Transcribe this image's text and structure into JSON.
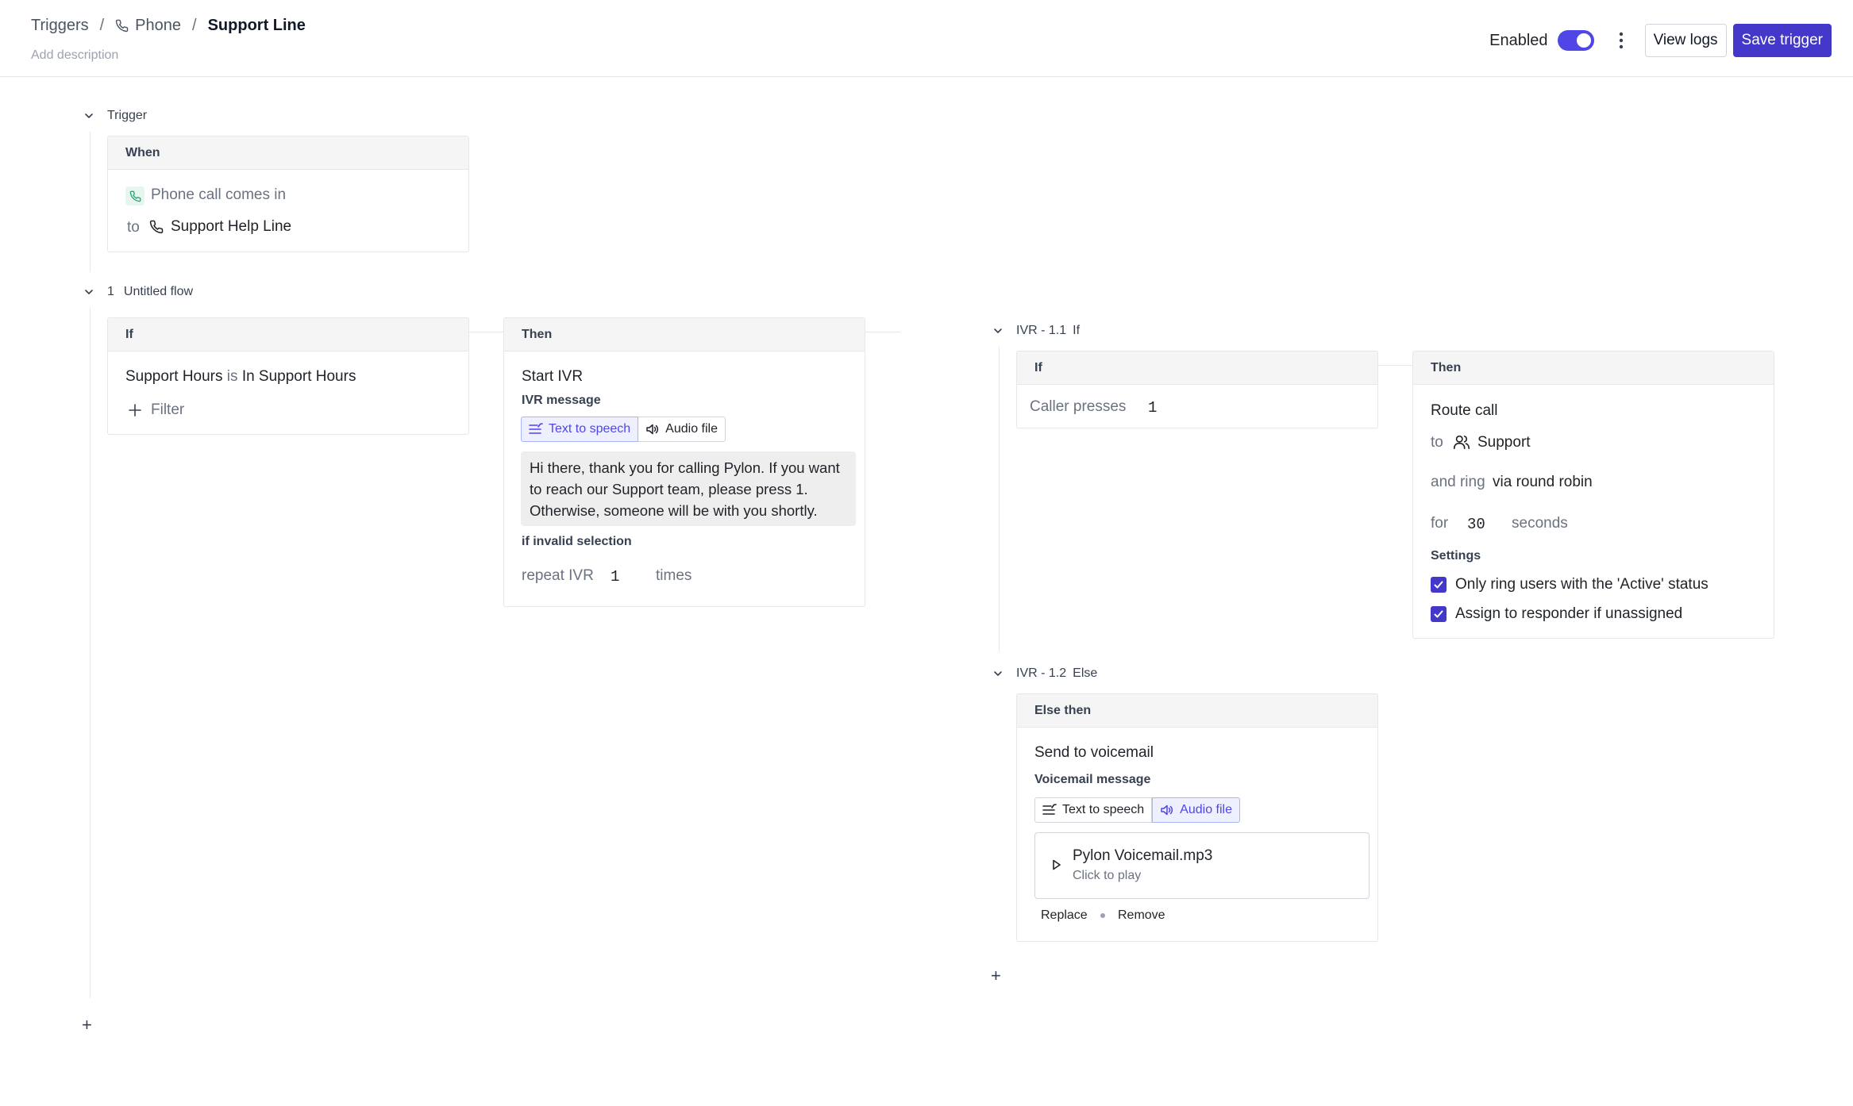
{
  "breadcrumb": {
    "triggers": "Triggers",
    "phone": "Phone",
    "current": "Support Line",
    "add_description": "Add description"
  },
  "header": {
    "enabled_label": "Enabled",
    "view_logs": "View logs",
    "save_trigger": "Save trigger"
  },
  "trigger": {
    "section_title": "Trigger",
    "card_head": "When",
    "event": "Phone call comes in",
    "to_label": "to",
    "line_name": "Support Help Line"
  },
  "flow": {
    "number": "1",
    "title": "Untitled flow",
    "if_card": {
      "head": "If",
      "condition_field": "Support Hours",
      "condition_op": "is",
      "condition_value": "In Support Hours",
      "filter_label": "Filter"
    },
    "then_card": {
      "head": "Then",
      "action": "Start IVR",
      "message_label": "IVR message",
      "tts_label": "Text to speech",
      "audio_label": "Audio file",
      "message": "Hi there, thank you for calling Pylon. If you want to reach our Support team, please press 1. Otherwise, someone will be with you shortly.",
      "invalid_label": "if invalid selection",
      "repeat_label": "repeat IVR",
      "repeat_value": "1",
      "times_label": "times"
    }
  },
  "ivr_1_1": {
    "title": "IVR - 1.1",
    "kind": "If",
    "if_card": {
      "head": "If",
      "label": "Caller presses",
      "value": "1"
    },
    "then_card": {
      "head": "Then",
      "action": "Route call",
      "to_label": "to",
      "team": "Support",
      "ring_label": "and ring",
      "ring_value": "via round robin",
      "for_label": "for",
      "for_value": "30",
      "seconds_label": "seconds",
      "settings_label": "Settings",
      "setting_1": "Only ring users with the 'Active' status",
      "setting_2": "Assign to responder if unassigned"
    }
  },
  "ivr_1_2": {
    "title": "IVR - 1.2",
    "kind": "Else",
    "card": {
      "head": "Else then",
      "action": "Send to voicemail",
      "message_label": "Voicemail message",
      "tts_label": "Text to speech",
      "audio_label": "Audio file",
      "file_name": "Pylon Voicemail.mp3",
      "file_hint": "Click to play",
      "replace_label": "Replace",
      "remove_label": "Remove"
    }
  },
  "colors": {
    "accent": "#4338ca",
    "toggle": "#4f46e5",
    "phone_icon": "#22a06b"
  },
  "icons": [
    "phone-icon",
    "chevron-down-icon",
    "kebab-menu-icon",
    "plus-icon",
    "text-to-speech-icon",
    "speaker-icon",
    "users-icon",
    "check-icon",
    "play-icon"
  ]
}
